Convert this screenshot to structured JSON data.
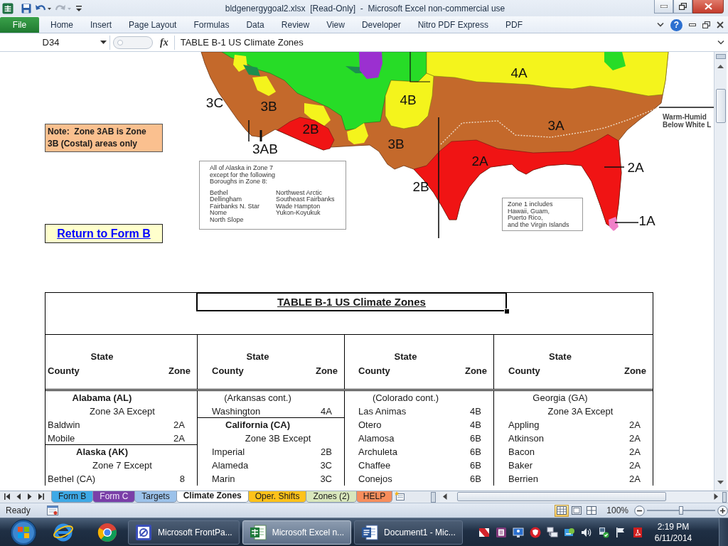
{
  "window": {
    "title": "bldgenergygoal2.xlsx  [Read-Only]  -  Microsoft Excel non-commercial use"
  },
  "quick_access": [
    {
      "kind": "save",
      "disabled": false
    },
    {
      "kind": "undo",
      "disabled": false
    },
    {
      "kind": "redo",
      "disabled": true
    },
    {
      "kind": "customize",
      "disabled": false
    }
  ],
  "ribbon": {
    "tabs": [
      {
        "label": "File",
        "kind": "file"
      },
      {
        "label": "Home",
        "kind": "tab"
      },
      {
        "label": "Insert",
        "kind": "tab"
      },
      {
        "label": "Page Layout",
        "kind": "tab"
      },
      {
        "label": "Formulas",
        "kind": "tab"
      },
      {
        "label": "Data",
        "kind": "tab"
      },
      {
        "label": "Review",
        "kind": "tab"
      },
      {
        "label": "View",
        "kind": "tab"
      },
      {
        "label": "Developer",
        "kind": "tab"
      },
      {
        "label": "Nitro PDF Express",
        "kind": "tab"
      },
      {
        "label": "PDF",
        "kind": "tab"
      }
    ],
    "help": "?"
  },
  "formula_bar": {
    "name_box": "D34",
    "function_button": "fx",
    "formula": "TABLE B-1 US Climate Zones"
  },
  "sheet": {
    "note": "Note:  Zone 3AB is Zone 3B (Costal) areas only",
    "return_link": "Return to Form B",
    "map": {
      "zone_labels": [
        "4A",
        "3C",
        "3B",
        "4B",
        "2B",
        "3A",
        "3AB",
        "3B",
        "2A",
        "2A",
        "2B",
        "1A"
      ],
      "alaska_note": "All of Alaska in Zone 7\nexcept for the following\nBoroughs in Zone 8:",
      "boroughs": [
        [
          "Bethel",
          "Dellingham",
          "Fairbanks N. Star",
          "Nome",
          "North Slope"
        ],
        [
          "Northwest Arctic",
          "Southeast Fairbanks",
          "Wade Hampton",
          "Yukon-Koyukuk"
        ]
      ],
      "zone1_note": "Zone 1 includes\nHawaii, Guam,\nPuerto Rico,\nand the Virgin Islands",
      "boundary_note": "Warm-Humid\nBelow White L"
    },
    "table": {
      "title": "TABLE B-1 US Climate Zones",
      "columns": [
        {
          "state": "State",
          "county": "County",
          "zone": "Zone"
        },
        {
          "state": "State",
          "county": "County",
          "zone": "Zone"
        },
        {
          "state": "State",
          "county": "County",
          "zone": "Zone"
        },
        {
          "state": "State",
          "county": "County",
          "zone": "Zone"
        }
      ],
      "blocks": [
        [
          {
            "kind": "heading",
            "text": "Alabama (AL)",
            "bold": true,
            "rule_below": false
          },
          {
            "kind": "except",
            "text": "Zone 3A Except",
            "bold": false,
            "rule_below": false
          },
          {
            "kind": "county",
            "county": "Baldwin",
            "zone": "2A",
            "bold": false,
            "rule_below": false
          },
          {
            "kind": "county",
            "county": "Mobile",
            "zone": "2A",
            "bold": false,
            "rule_below": true
          },
          {
            "kind": "heading",
            "text": "Alaska (AK)",
            "bold": true,
            "rule_below": false
          },
          {
            "kind": "except",
            "text": "Zone 7 Except",
            "bold": false,
            "rule_below": false
          },
          {
            "kind": "county",
            "county": "Bethel (CA)",
            "zone": "8",
            "bold": false,
            "rule_below": false
          }
        ],
        [
          {
            "kind": "heading",
            "text": "(Arkansas cont.)",
            "bold": false,
            "rule_below": false
          },
          {
            "kind": "county",
            "county": "Washington",
            "zone": "4A",
            "bold": false,
            "rule_below": true
          },
          {
            "kind": "heading",
            "text": "California (CA)",
            "bold": true,
            "rule_below": false
          },
          {
            "kind": "except",
            "text": "Zone 3B Except",
            "bold": false,
            "rule_below": false
          },
          {
            "kind": "county",
            "county": "Imperial",
            "zone": "2B",
            "bold": false,
            "rule_below": false
          },
          {
            "kind": "county",
            "county": "Alameda",
            "zone": "3C",
            "bold": false,
            "rule_below": false
          },
          {
            "kind": "county",
            "county": "Marin",
            "zone": "3C",
            "bold": false,
            "rule_below": false
          }
        ],
        [
          {
            "kind": "heading",
            "text": "(Colorado cont.)",
            "bold": false,
            "rule_below": false
          },
          {
            "kind": "county",
            "county": "Las Animas",
            "zone": "4B",
            "bold": false,
            "rule_below": false
          },
          {
            "kind": "county",
            "county": "Otero",
            "zone": "4B",
            "bold": false,
            "rule_below": false
          },
          {
            "kind": "county",
            "county": "Alamosa",
            "zone": "6B",
            "bold": false,
            "rule_below": false
          },
          {
            "kind": "county",
            "county": "Archuleta",
            "zone": "6B",
            "bold": false,
            "rule_below": false
          },
          {
            "kind": "county",
            "county": "Chaffee",
            "zone": "6B",
            "bold": false,
            "rule_below": false
          },
          {
            "kind": "county",
            "county": "Conejos",
            "zone": "6B",
            "bold": false,
            "rule_below": false
          }
        ],
        [
          {
            "kind": "heading",
            "text": "Georgia (GA)",
            "bold": false,
            "rule_below": false
          },
          {
            "kind": "except",
            "text": "Zone 3A Except",
            "bold": false,
            "rule_below": false
          },
          {
            "kind": "county",
            "county": "Appling",
            "zone": "2A",
            "bold": false,
            "rule_below": false
          },
          {
            "kind": "county",
            "county": "Atkinson",
            "zone": "2A",
            "bold": false,
            "rule_below": false
          },
          {
            "kind": "county",
            "county": "Bacon",
            "zone": "2A",
            "bold": false,
            "rule_below": false
          },
          {
            "kind": "county",
            "county": "Baker",
            "zone": "2A",
            "bold": false,
            "rule_below": false
          },
          {
            "kind": "county",
            "county": "Berrien",
            "zone": "2A",
            "bold": false,
            "rule_below": false
          }
        ]
      ]
    }
  },
  "sheet_tabs": [
    {
      "label": "Form B",
      "selected": false,
      "color": "#3ea9e6"
    },
    {
      "label": "Form C",
      "selected": false,
      "color": "#7a3fa8"
    },
    {
      "label": "Targets",
      "selected": false,
      "color": "#9cc2ea"
    },
    {
      "label": "Climate Zones",
      "selected": true
    },
    {
      "label": "Oper. Shifts",
      "selected": false,
      "color": "#ffc21a"
    },
    {
      "label": "Zones (2)",
      "selected": false,
      "color": "#d8e6bc"
    },
    {
      "label": "HELP",
      "selected": false,
      "color": "#f78d5c"
    }
  ],
  "status_bar": {
    "text": "Ready",
    "views": [
      {
        "kind": "normal",
        "selected": true
      },
      {
        "kind": "page_layout",
        "selected": false
      },
      {
        "kind": "page_break",
        "selected": false
      }
    ],
    "zoom": {
      "label": "100%",
      "level": 0.5
    }
  },
  "taskbar": {
    "tasks": [
      {
        "label": "Microsoft FrontPa...",
        "kind": "web",
        "selected": false
      },
      {
        "label": "Microsoft Excel n...",
        "kind": "spreadsheet",
        "selected": true
      },
      {
        "label": "Document1 - Mic...",
        "kind": "document",
        "selected": false
      }
    ],
    "time": "2:19 PM",
    "date": "6/11/2014"
  }
}
